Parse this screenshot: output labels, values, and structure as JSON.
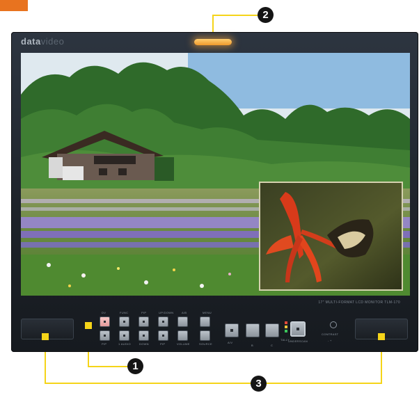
{
  "brand": {
    "name": "data",
    "name_suffix": "video"
  },
  "callouts": [
    {
      "id": "1",
      "label": "1"
    },
    {
      "id": "2",
      "label": "2"
    },
    {
      "id": "3",
      "label": "3"
    }
  ],
  "model_label": "17\" MULTI-FORMAT LCD MONITOR  TLM-170",
  "panel": {
    "button_labels_top": [
      "DV",
      "FUNC",
      "PIP",
      "UP/DOWN",
      "A/B",
      "MENU"
    ],
    "button_labels_bottom": [
      "PIP",
      "1 AUDIO",
      "DOWN",
      "PIP",
      "VOLUME",
      "SOURCE"
    ],
    "input_labels": [
      "A/V",
      "B",
      "C"
    ],
    "tally_label": "TALLY",
    "underscan_label": "UNDERSCAN",
    "contrast_label": "CONTRAST",
    "contrast_range": "- +"
  },
  "colors": {
    "accent": "#e8731f",
    "callout_line": "#f5d419",
    "tally": "#f6a63c",
    "bezel": "#1d2229"
  }
}
